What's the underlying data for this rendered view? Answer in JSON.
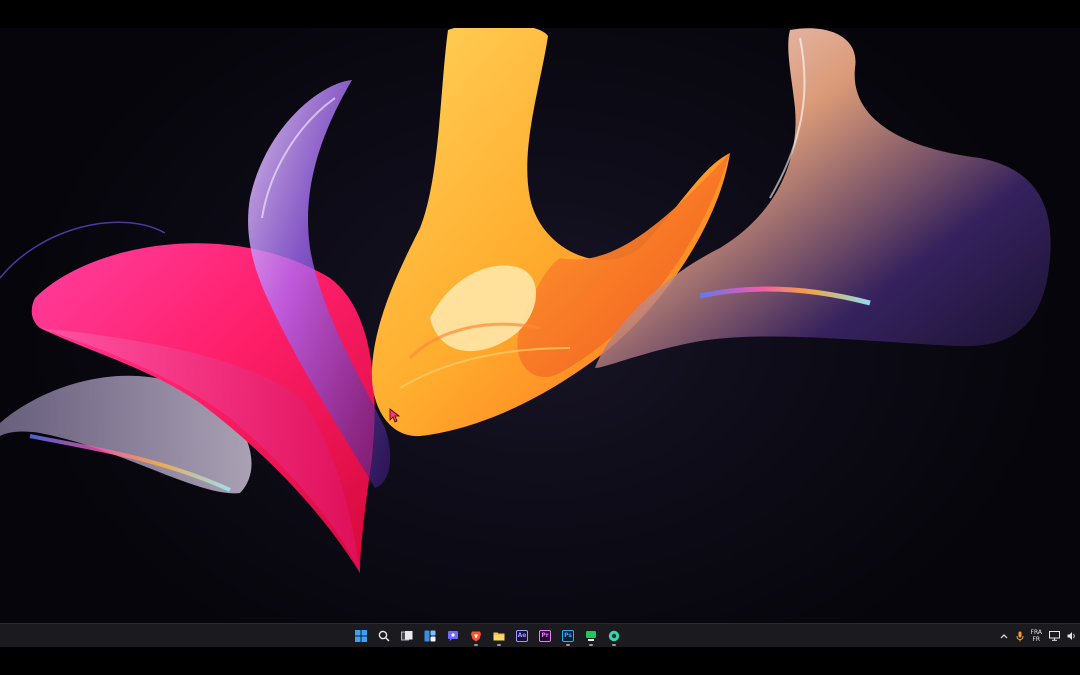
{
  "desktop": {
    "wallpaper": "abstract-3d-ribbon-wallpaper"
  },
  "taskbar": {
    "pinned": [
      {
        "id": "start",
        "icon": "windows-start-icon",
        "running": false
      },
      {
        "id": "search",
        "icon": "search-icon",
        "running": false
      },
      {
        "id": "task-view",
        "icon": "task-view-icon",
        "running": false
      },
      {
        "id": "widgets",
        "icon": "widgets-icon",
        "running": false
      },
      {
        "id": "chat",
        "icon": "chat-icon",
        "running": false
      },
      {
        "id": "brave",
        "icon": "brave-browser-icon",
        "running": true
      },
      {
        "id": "explorer",
        "icon": "file-explorer-icon",
        "running": true
      },
      {
        "id": "after-effects",
        "icon": "after-effects-icon",
        "label": "Ae",
        "running": false
      },
      {
        "id": "premiere",
        "icon": "premiere-pro-icon",
        "label": "Pr",
        "running": false
      },
      {
        "id": "photoshop",
        "icon": "photoshop-icon",
        "label": "Ps",
        "running": true
      },
      {
        "id": "app-green",
        "icon": "app-icon",
        "running": true
      },
      {
        "id": "screen-recorder",
        "icon": "screen-recorder-icon",
        "running": true
      }
    ],
    "tray": {
      "chevron": "chevron-up-icon",
      "mic": "microphone-icon",
      "language_top": "FRA",
      "language_bottom": "FR",
      "network": "network-icon",
      "volume": "volume-icon"
    }
  },
  "colors": {
    "taskbar_bg": "#1b1b1f",
    "start_blue": "#3aa0ff",
    "brave_orange": "#fb542b",
    "explorer_yellow": "#f6c342",
    "ae_purple": "#9999ff",
    "pr_purple": "#ea77ff",
    "ps_blue": "#31a8ff",
    "app_green": "#22c55e",
    "recorder_teal": "#3fd0b0"
  }
}
